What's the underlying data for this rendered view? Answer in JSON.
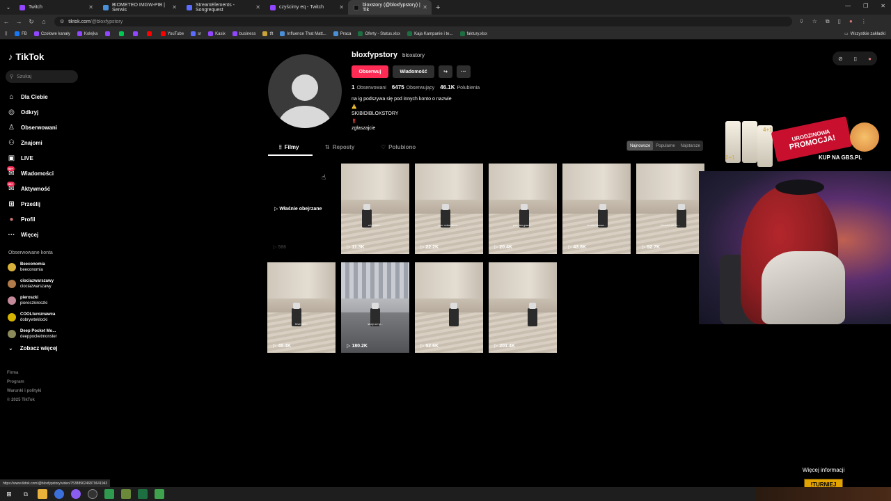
{
  "browser": {
    "tabs": [
      {
        "title": "Twitch",
        "color": "#9146ff"
      },
      {
        "title": "BIOMETEO IMGW-PIB | Serwis",
        "color": "#4a90d9"
      },
      {
        "title": "StreamElements - Songrequest",
        "color": "#5b6cff"
      },
      {
        "title": "czyścimy eq - Twitch",
        "color": "#9146ff"
      },
      {
        "title": "bloxstory (@bloxfypstory) | Tik",
        "color": "#111111"
      }
    ],
    "url_domain": "tiktok.com",
    "url_path": "/@bloxfypstory",
    "bookmarks": [
      {
        "label": "FB",
        "color": "#1877f2"
      },
      {
        "label": "Czołowe kanały",
        "color": "#9146ff"
      },
      {
        "label": "Kolejka",
        "color": "#9146ff"
      },
      {
        "label": "",
        "color": "#9146ff"
      },
      {
        "label": "",
        "color": "#00c853"
      },
      {
        "label": "",
        "color": "#9146ff"
      },
      {
        "label": "",
        "color": "#ff0000"
      },
      {
        "label": "YouTube",
        "color": "#ff0000"
      },
      {
        "label": "sr",
        "color": "#5b6cff"
      },
      {
        "label": "Kasix",
        "color": "#9146ff"
      },
      {
        "label": "business",
        "color": "#9146ff"
      },
      {
        "label": "tft",
        "color": "#c8a23a"
      },
      {
        "label": "Influence That Matt...",
        "color": "#4a90d9"
      },
      {
        "label": "Praca",
        "color": "#4a90d9"
      },
      {
        "label": "Oferty - Status.xlsx",
        "color": "#1d6f42"
      },
      {
        "label": "Kaja Kampanie i te...",
        "color": "#1d6f42"
      },
      {
        "label": "faktury.xlsx",
        "color": "#1d6f42"
      }
    ],
    "bookmarks_all": "Wszystkie zakładki",
    "status_url": "https://www.tiktok.com/@bloxfypstory/video/7538896246870641943"
  },
  "tiktok": {
    "logo": "TikTok",
    "search_placeholder": "Szukaj",
    "nav": [
      {
        "label": "Dla Ciebie",
        "icon": "home-icon"
      },
      {
        "label": "Odkryj",
        "icon": "compass-icon"
      },
      {
        "label": "Obserwowani",
        "icon": "person-icon"
      },
      {
        "label": "Znajomi",
        "icon": "friends-icon"
      },
      {
        "label": "LIVE",
        "icon": "live-icon"
      },
      {
        "label": "Wiadomości",
        "icon": "message-icon",
        "badge": "99+"
      },
      {
        "label": "Aktywność",
        "icon": "activity-icon",
        "badge": "99+"
      },
      {
        "label": "Prześlij",
        "icon": "upload-icon"
      },
      {
        "label": "Profil",
        "icon": "avatar-icon"
      },
      {
        "label": "Więcej",
        "icon": "more-icon"
      }
    ],
    "followed_title": "Obserwowane konta",
    "followed": [
      {
        "name": "Beeconomia",
        "handle": "beeconomia",
        "color": "#d9b23b"
      },
      {
        "name": "ciociazwarszawy",
        "handle": "ciociazwarszawy",
        "color": "#b07a4a"
      },
      {
        "name": "pieroszki",
        "handle": "pieroszkiroszki",
        "color": "#c48a9a"
      },
      {
        "name": "COOLturoznawca",
        "handle": "dobrywteklocki",
        "color": "#d6b300"
      },
      {
        "name": "Deep Pocket Mo...",
        "handle": "deeppocketmonster",
        "color": "#8a8a5a"
      }
    ],
    "see_more": "Zobacz więcej",
    "footer": [
      "Firma",
      "Program",
      "Warunki i polityki",
      "© 2025 TikTok"
    ]
  },
  "profile": {
    "username": "bloxfypstory",
    "nickname": "bloxstory",
    "follow_label": "Obserwuj",
    "message_label": "Wiadomość",
    "stats": {
      "following": "1",
      "following_label": "Obserwowani",
      "followers": "6475",
      "followers_label": "Obserwujący",
      "likes": "46.1K",
      "likes_label": "Polubienia"
    },
    "bio": [
      "na ig podszywa się pod innych konto o nazwie",
      "⚠️",
      "SKIBIDIBLOXSTORY",
      "‼️",
      "zgłaszajcie"
    ],
    "tabs": [
      "Filmy",
      "Reposty",
      "Polubiono"
    ],
    "sort": [
      "Najnowsze",
      "Popularne",
      "Najstarsze"
    ],
    "watched_label": "Właśnie obejrzane",
    "watched_views": "586",
    "videos": [
      {
        "views": "11.3K",
        "caption": "a ty masz..."
      },
      {
        "views": "22.2K",
        "caption": "pov: rekordwoe..."
      },
      {
        "views": "20.4K",
        "caption": "pov: ten gracz..."
      },
      {
        "views": "43.8K",
        "caption": "w wiku mowa..."
      },
      {
        "views": "52.7K",
        "caption": "jeszcze sie tu..."
      },
      {
        "views": "45.4K",
        "caption": "fever od..."
      },
      {
        "views": "180.2K",
        "caption": "story od ty..."
      },
      {
        "views": "52.6K",
        "caption": ""
      },
      {
        "views": "201.4K",
        "caption": ""
      }
    ]
  },
  "overlay": {
    "promo_line1": "URODZINOWA",
    "promo_line2": "PROMOCJA!",
    "promo_shop": "KUP NA GBS.PL",
    "promo_tag1": "4+1",
    "promo_tag2": "2+1",
    "more_info": "Więcej informacji",
    "tournament": "!TURNIEJ"
  }
}
